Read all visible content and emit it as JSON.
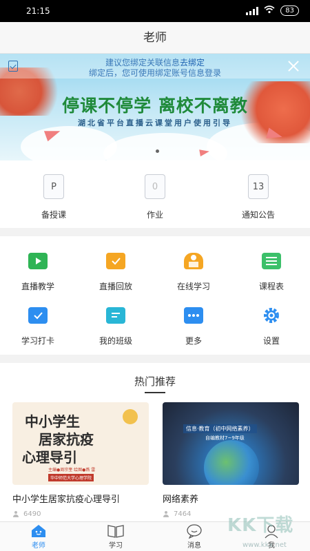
{
  "status_bar": {
    "time": "21:15",
    "battery": "83"
  },
  "header": {
    "title": "老师"
  },
  "banner": {
    "bind_tip_prefix": "建议您绑定关联信息",
    "bind_tip_link": "去绑定",
    "bind_tip_line2": "绑定后，您可使用绑定账号信息登录",
    "headline": "停课不停学  离校不离教",
    "subline": "湖北省平台直播云课堂用户使用引导"
  },
  "quick_actions": [
    {
      "label": "备授课",
      "glyph": "P",
      "icon": "lesson-prep-icon"
    },
    {
      "label": "作业",
      "glyph": "0",
      "icon": "homework-icon"
    },
    {
      "label": "通知公告",
      "glyph": "13",
      "icon": "notice-icon"
    }
  ],
  "features": [
    {
      "label": "直播教学",
      "icon": "live-teaching-icon",
      "color": "#2fb455"
    },
    {
      "label": "直播回放",
      "icon": "live-playback-icon",
      "color": "#f5a623"
    },
    {
      "label": "在线学习",
      "icon": "online-learning-icon",
      "color": "#f5a623"
    },
    {
      "label": "课程表",
      "icon": "timetable-icon",
      "color": "#3cc06a"
    },
    {
      "label": "学习打卡",
      "icon": "checkin-icon",
      "color": "#2d8ef0"
    },
    {
      "label": "我的班级",
      "icon": "my-class-icon",
      "color": "#29b6d6"
    },
    {
      "label": "更多",
      "icon": "more-icon",
      "color": "#2d8ef0"
    },
    {
      "label": "设置",
      "icon": "settings-icon",
      "color": "#2d8ef0"
    }
  ],
  "hot": {
    "title": "热门推荐",
    "cards": [
      {
        "title": "中小学生居家抗疫心理导引",
        "views": "6490",
        "img_text_1": "中小学生",
        "img_text_2": "居家抗疫",
        "img_text_3": "心理导引",
        "img_caption": "主编●周宗奎   绘图●燕 雷",
        "img_logo": "华中师范大学心理学院"
      },
      {
        "title": "网络素养",
        "views": "7464",
        "img_text_1": "信息·教育（初中网络素养）",
        "img_text_2": "自编教材7~9年级"
      }
    ]
  },
  "tabbar": [
    {
      "label": "老师",
      "icon": "home-icon",
      "active": true
    },
    {
      "label": "学习",
      "icon": "book-icon",
      "active": false
    },
    {
      "label": "消息",
      "icon": "message-icon",
      "active": false
    },
    {
      "label": "我",
      "icon": "profile-icon",
      "active": false
    }
  ],
  "watermark": {
    "text": "KK下载",
    "url": "www.kkx.net"
  }
}
